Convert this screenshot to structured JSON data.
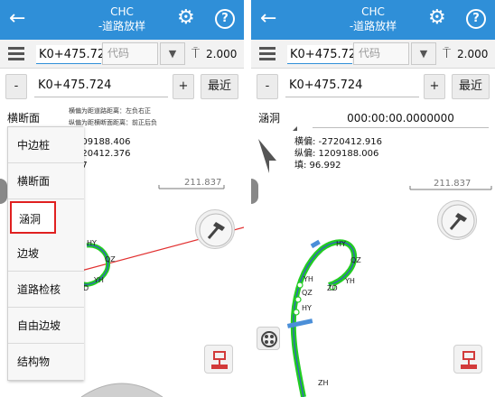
{
  "left": {
    "topbar": {
      "title_line1": "CHC",
      "title_line2": "-道路放样",
      "back_icon": "back-arrow-icon",
      "settings_icon": "gear-icon",
      "help_label": "?"
    },
    "stake_point": "K0+475.72",
    "code_placeholder": "代码",
    "height": "2.000",
    "minus_label": "-",
    "stake_value": "K0+475.724",
    "plus_label": "+",
    "nearest_label": "最近",
    "mode": "横断面",
    "hint_line1": "横偏为距道路距离：左负右正",
    "hint_line2": "纵偏为距横断面距离：前正后负",
    "info_line1": "209188.406",
    "info_line2": "720412.376",
    "info_line3": "47",
    "scale_value": "211.837",
    "menu_items": [
      "中边桩",
      "横断面",
      "涵洞",
      "边坡",
      "道路检核",
      "自由边坡",
      "结构物"
    ],
    "curve_labels": {
      "hy": "HY",
      "qz": "QZ",
      "yh": "YH",
      "zd": "D"
    }
  },
  "right": {
    "topbar": {
      "title_line1": "CHC",
      "title_line2": "-道路放样",
      "back_icon": "back-arrow-icon",
      "settings_icon": "gear-icon",
      "help_label": "?"
    },
    "stake_point": "K0+475.72",
    "code_placeholder": "代码",
    "height": "2.000",
    "minus_label": "-",
    "stake_value": "K0+475.724",
    "plus_label": "+",
    "nearest_label": "最近",
    "mode": "涵洞",
    "time_value": "000:00:00.0000000",
    "offset_label": "横偏: -2720412.916",
    "longitudinal_label": "纵偏: 1209188.006",
    "fill_label": "填: 96.992",
    "scale_value": "211.837",
    "curve_labels": {
      "hy_top": "HY",
      "qz_top": "QZ",
      "yh_mid": "YH",
      "zd": "ZD",
      "yh_left": "YH",
      "qz_left": "QZ",
      "hy_left": "HY",
      "zh": "ZH"
    }
  },
  "colors": {
    "topbar": "#2f8fd8",
    "road_line": "#22cc22",
    "alignment": "#3355cc",
    "selection": "#e02020",
    "red_axis": "#e23030",
    "tool_red": "#d23a3a"
  }
}
